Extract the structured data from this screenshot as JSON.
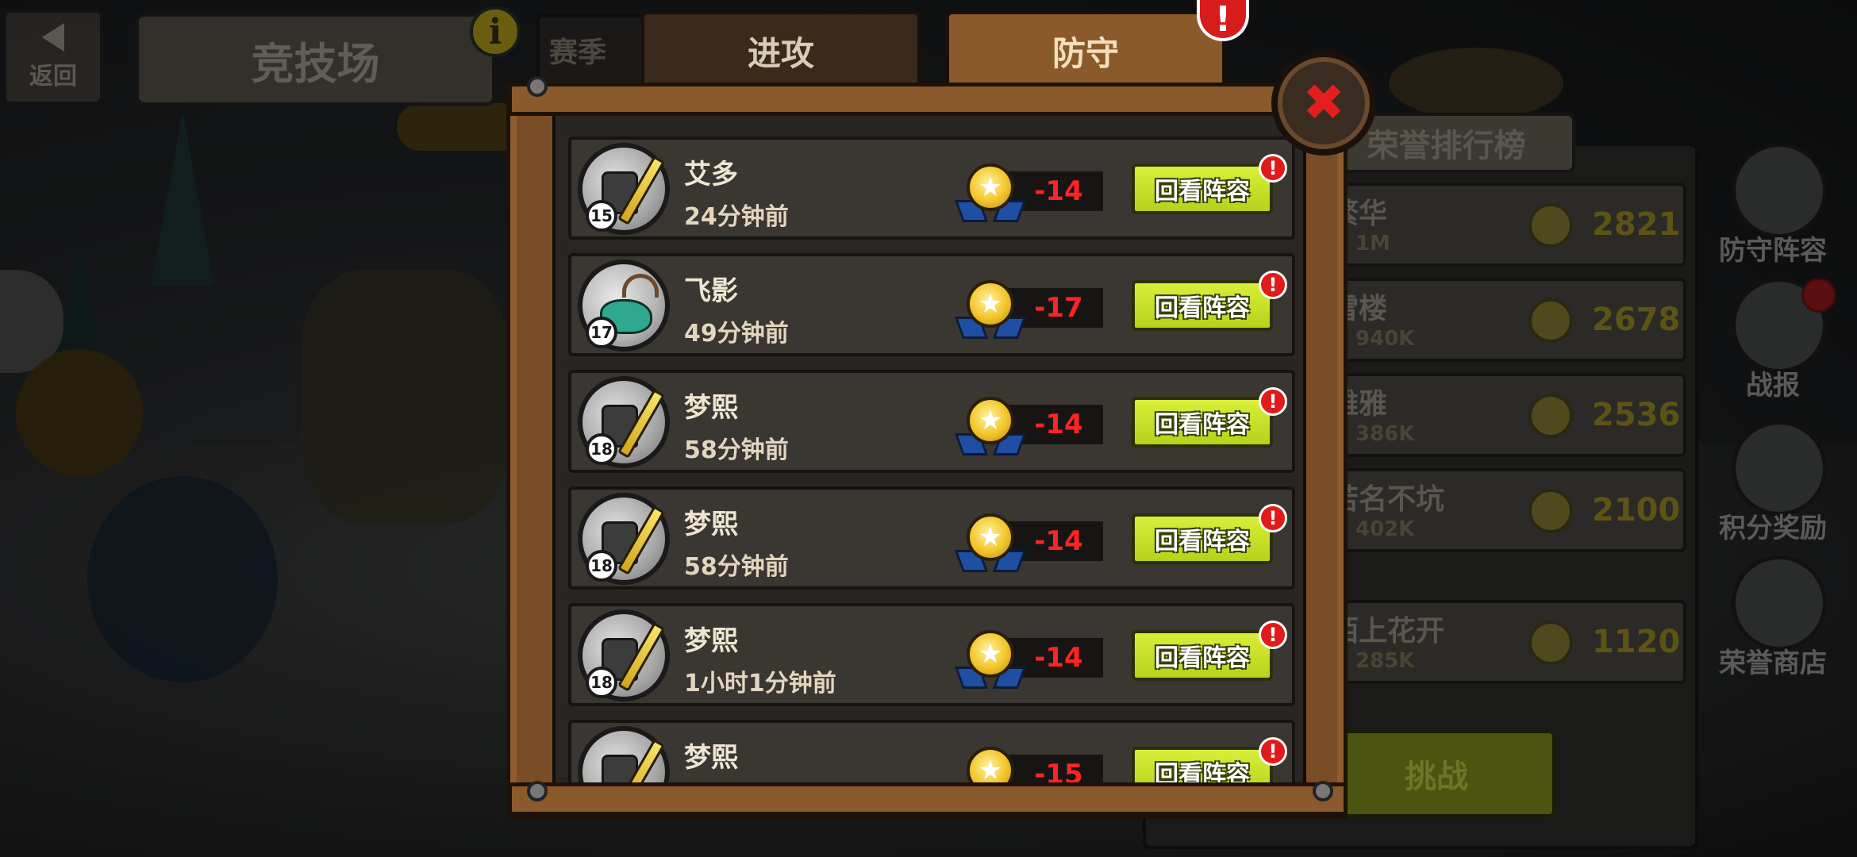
{
  "background": {
    "back_label": "返回",
    "title": "竞技场",
    "info_icon": "i",
    "season_tag": "赛季",
    "ranking": {
      "title": "荣誉排行榜",
      "rows": [
        {
          "name": "繁华",
          "power": "1M",
          "score": "2821"
        },
        {
          "name": "雷楼",
          "power": "940K",
          "score": "2678"
        },
        {
          "name": "雅雅",
          "power": "386K",
          "score": "2536"
        },
        {
          "name": "若名不坑",
          "power": "402K",
          "score": "2100"
        },
        {
          "name": "陌上花开",
          "power": "285K",
          "score": "1120"
        }
      ],
      "challenge_label": "挑战"
    },
    "side_buttons": [
      {
        "label": "防守阵容"
      },
      {
        "label": "战报"
      },
      {
        "label": "积分奖励"
      },
      {
        "label": "荣誉商店"
      }
    ]
  },
  "modal": {
    "tabs": {
      "attack": "进攻",
      "defense": "防守"
    },
    "active_tab": "defense",
    "tab_alert": "!",
    "close_icon": "✖",
    "records": [
      {
        "name": "艾多",
        "time": "24分钟前",
        "level": "15",
        "delta": "-14",
        "button": "回看阵容",
        "alert": "!",
        "avatar": "knight-avatar"
      },
      {
        "name": "飞影",
        "time": "49分钟前",
        "level": "17",
        "delta": "-17",
        "button": "回看阵容",
        "alert": "!",
        "avatar": "deer-rider-avatar"
      },
      {
        "name": "梦熙",
        "time": "58分钟前",
        "level": "18",
        "delta": "-14",
        "button": "回看阵容",
        "alert": "!",
        "avatar": "knight-avatar"
      },
      {
        "name": "梦熙",
        "time": "58分钟前",
        "level": "18",
        "delta": "-14",
        "button": "回看阵容",
        "alert": "!",
        "avatar": "knight-avatar"
      },
      {
        "name": "梦熙",
        "time": "1小时1分钟前",
        "level": "18",
        "delta": "-14",
        "button": "回看阵容",
        "alert": "!",
        "avatar": "knight-avatar"
      },
      {
        "name": "梦熙",
        "time": "",
        "level": "",
        "delta": "-15",
        "button": "回看阵容",
        "alert": "!",
        "avatar": "knight-avatar"
      }
    ]
  },
  "colors": {
    "accent_green": "#c8e02a",
    "loss_red": "#ff2424",
    "wood": "#7a4d26",
    "active_tab": "#8a5a2a"
  }
}
